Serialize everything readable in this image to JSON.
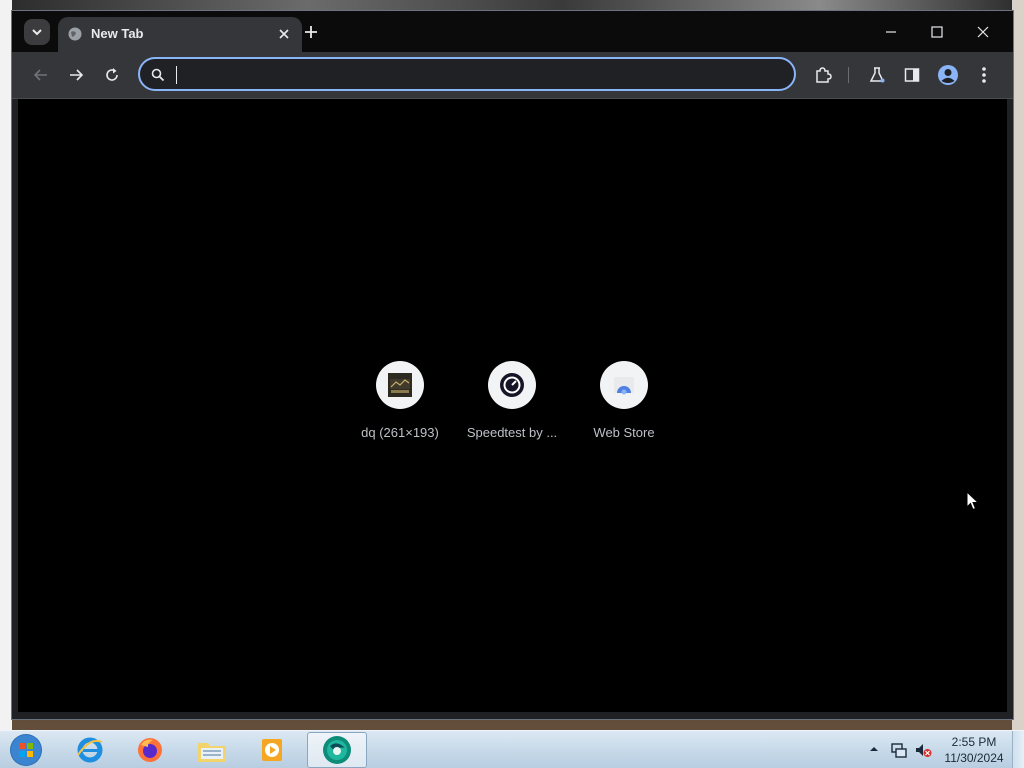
{
  "browser": {
    "tab": {
      "title": "New Tab"
    },
    "omnibox": {
      "value": "",
      "placeholder": ""
    }
  },
  "shortcuts": [
    {
      "label": "dq (261×193)",
      "icon": "dq-thumbnail-icon"
    },
    {
      "label": "Speedtest by ...",
      "icon": "speedometer-icon"
    },
    {
      "label": "Web Store",
      "icon": "web-store-icon"
    }
  ],
  "taskbar": {
    "apps": [
      "internet-explorer-icon",
      "firefox-icon",
      "file-explorer-icon",
      "media-player-icon",
      "browser-icon"
    ],
    "clock": {
      "time": "2:55 PM",
      "date": "11/30/2024"
    }
  },
  "colors": {
    "accent": "#8ab4f8",
    "toolbar": "#35363a",
    "titlebar": "#0b0b0c",
    "content": "#000000"
  }
}
